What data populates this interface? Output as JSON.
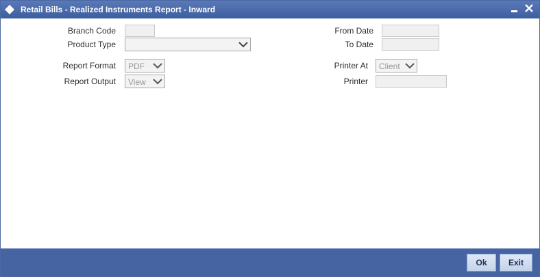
{
  "window": {
    "title": "Retail Bills - Realized Instruments Report - Inward",
    "minimize_icon": "minimize-icon",
    "close_icon": "close-icon"
  },
  "form": {
    "branch_code": {
      "label": "Branch Code",
      "value": ""
    },
    "product_type": {
      "label": "Product Type",
      "value": ""
    },
    "report_format": {
      "label": "Report Format",
      "value": "PDF"
    },
    "report_output": {
      "label": "Report Output",
      "value": "View"
    },
    "from_date": {
      "label": "From Date",
      "value": ""
    },
    "to_date": {
      "label": "To Date",
      "value": ""
    },
    "printer_at": {
      "label": "Printer At",
      "value": "Client"
    },
    "printer": {
      "label": "Printer",
      "value": ""
    }
  },
  "footer": {
    "ok_label": "Ok",
    "exit_label": "Exit"
  },
  "colors": {
    "titlebar": "#3d5f9f",
    "footer": "#4764a2",
    "button": "#c3d3ea"
  }
}
